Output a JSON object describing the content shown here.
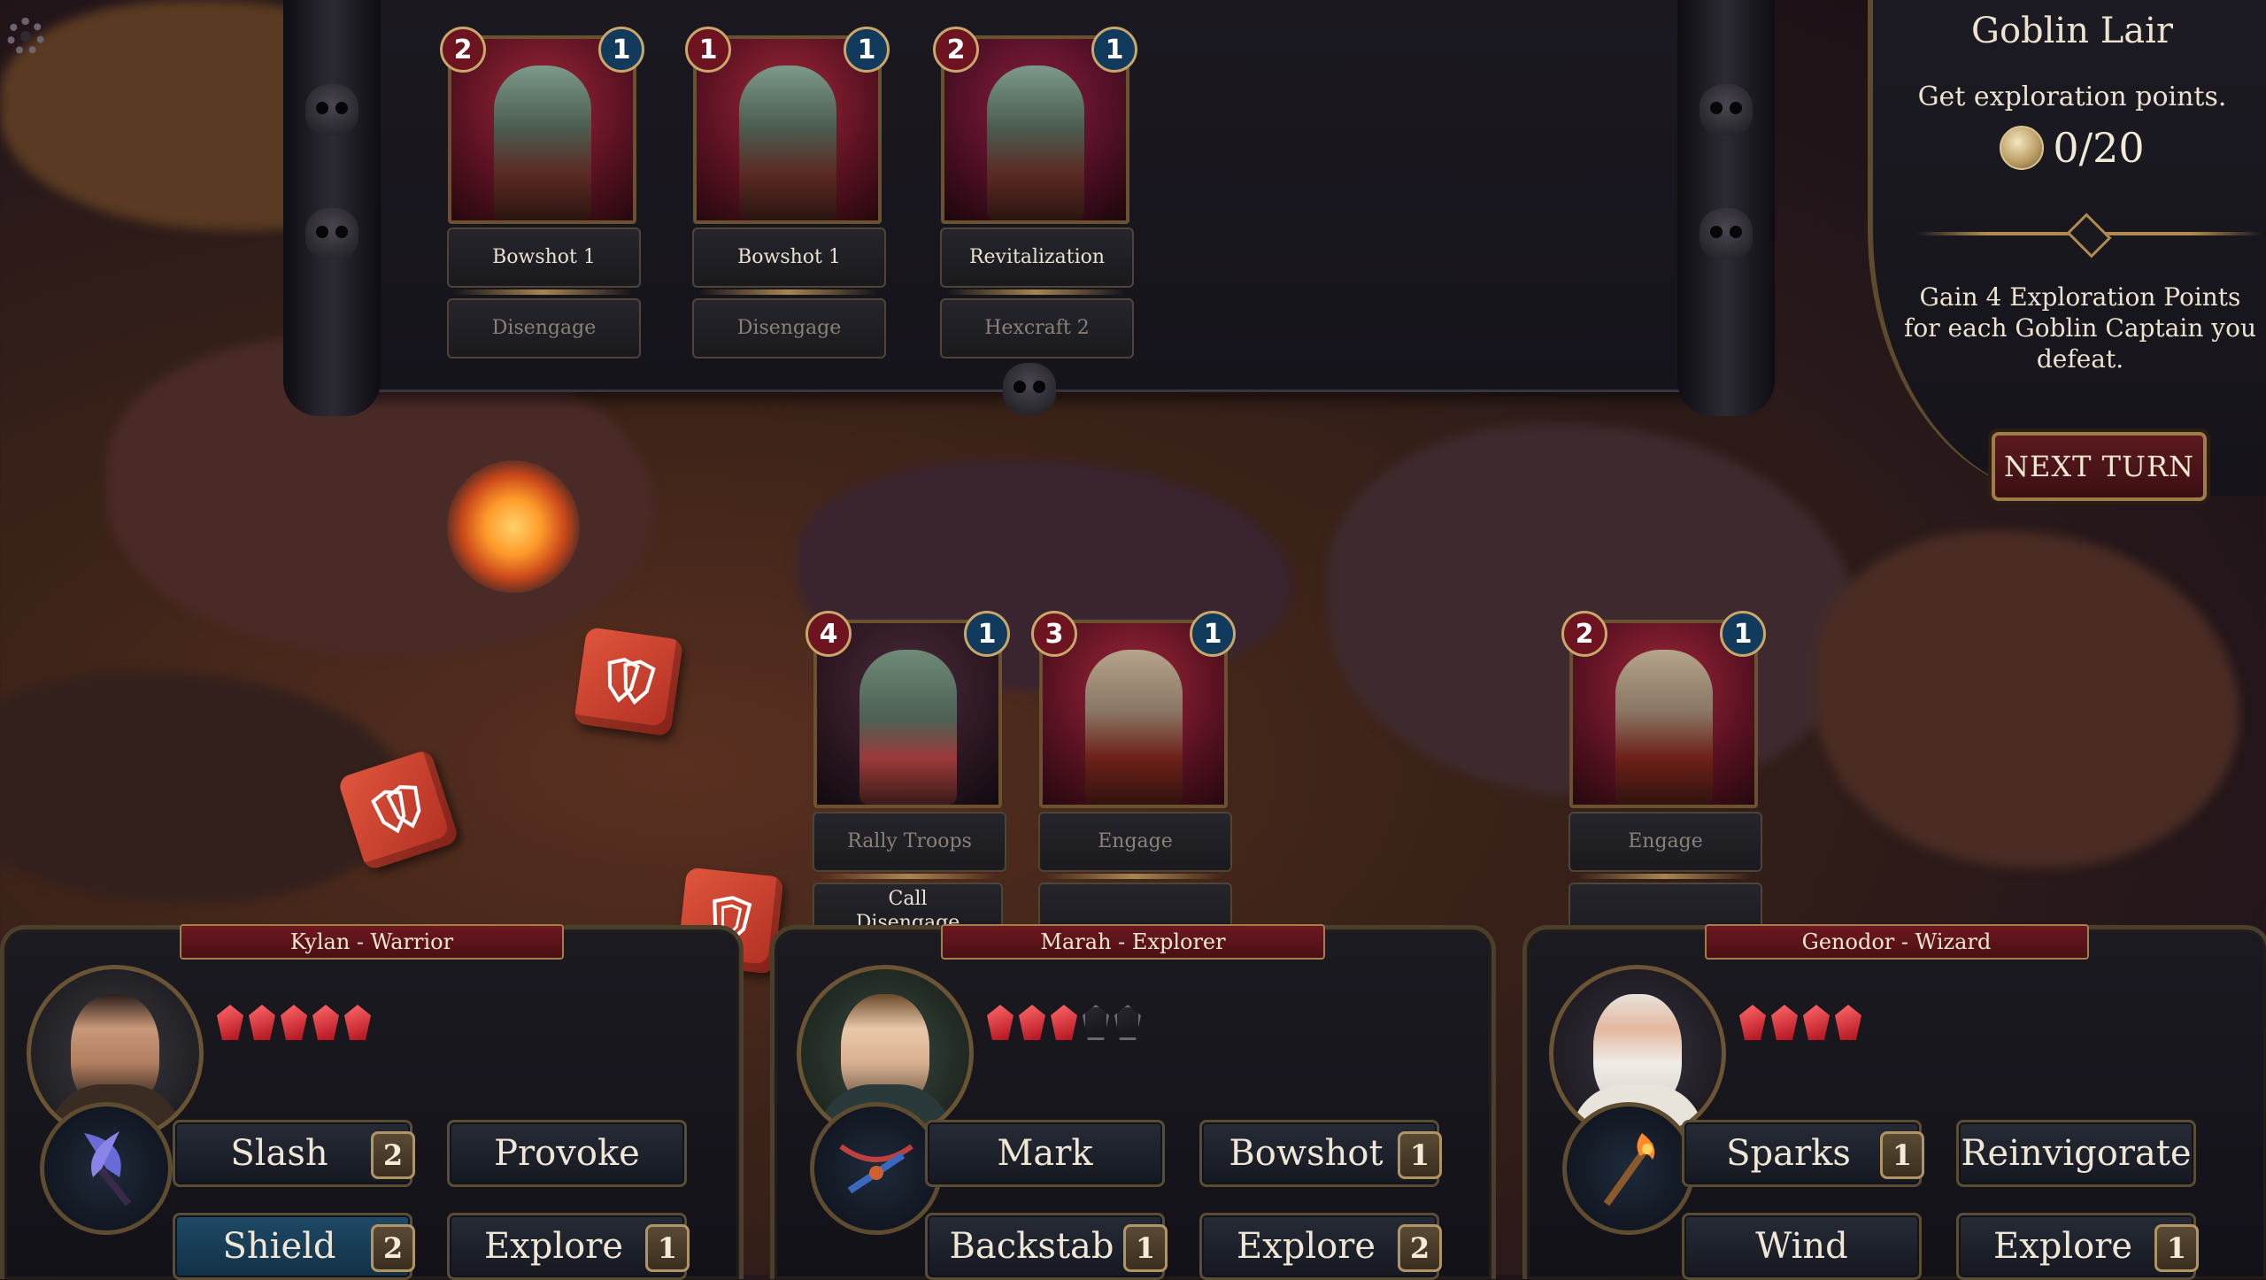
{
  "scenario": {
    "title": "Goblin Lair",
    "goal": "Get exploration points.",
    "progress": "0/20",
    "progress_value": 0,
    "progress_max": 20,
    "description": "Gain 4 Exploration Points for each Goblin Captain you defeat.",
    "next_turn_label": "NEXT TURN"
  },
  "enemy_row": [
    {
      "attack": "2",
      "defense": "1",
      "action": "Bowshot 1",
      "next": "Disengage",
      "art": "goblin-archer"
    },
    {
      "attack": "1",
      "defense": "1",
      "action": "Bowshot 1",
      "next": "Disengage",
      "art": "goblin-archer"
    },
    {
      "attack": "2",
      "defense": "1",
      "action": "Revitalization",
      "next": "Hexcraft 2",
      "art": "goblin-shaman"
    }
  ],
  "battle_row": [
    {
      "attack": "4",
      "defense": "1",
      "action": "Rally Troops",
      "next": "Call Disengage",
      "art": "goblin-captain"
    },
    {
      "attack": "3",
      "defense": "1",
      "action": "Engage",
      "next": "",
      "art": "goblin-brute"
    },
    {
      "attack": "2",
      "defense": "1",
      "action": "Engage",
      "next": "",
      "art": "goblin-brute"
    }
  ],
  "dice": [
    {
      "face": "double-shield"
    },
    {
      "face": "double-shield"
    },
    {
      "face": "shield"
    }
  ],
  "heroes": [
    {
      "name": "Kylan - Warrior",
      "health": 5,
      "health_max": 5,
      "weapon_icon": "axe-icon",
      "abilities": [
        {
          "label": "Slash",
          "cost": "2",
          "selected": false
        },
        {
          "label": "Provoke",
          "cost": "",
          "selected": false
        },
        {
          "label": "Shield",
          "cost": "2",
          "selected": true
        },
        {
          "label": "Explore",
          "cost": "1",
          "selected": false
        }
      ]
    },
    {
      "name": "Marah - Explorer",
      "health": 3,
      "health_max": 5,
      "weapon_icon": "crossbow-icon",
      "abilities": [
        {
          "label": "Mark",
          "cost": "",
          "selected": false
        },
        {
          "label": "Bowshot",
          "cost": "1",
          "selected": false
        },
        {
          "label": "Backstab",
          "cost": "1",
          "selected": false
        },
        {
          "label": "Explore",
          "cost": "2",
          "selected": false
        }
      ]
    },
    {
      "name": "Genodor - Wizard",
      "health": 4,
      "health_max": 4,
      "weapon_icon": "fire-staff-icon",
      "abilities": [
        {
          "label": "Sparks",
          "cost": "1",
          "selected": false
        },
        {
          "label": "Reinvigorate",
          "cost": "",
          "selected": false
        },
        {
          "label": "Wind",
          "cost": "",
          "selected": false
        },
        {
          "label": "Explore",
          "cost": "1",
          "selected": false
        }
      ]
    }
  ],
  "colors": {
    "panel": "#16141b",
    "accent_gold": "#b08a4e",
    "attack_badge": "#6e1420",
    "defense_badge": "#123a5c",
    "selected_ability": "#1f4a66",
    "heart": "#c0142a"
  }
}
